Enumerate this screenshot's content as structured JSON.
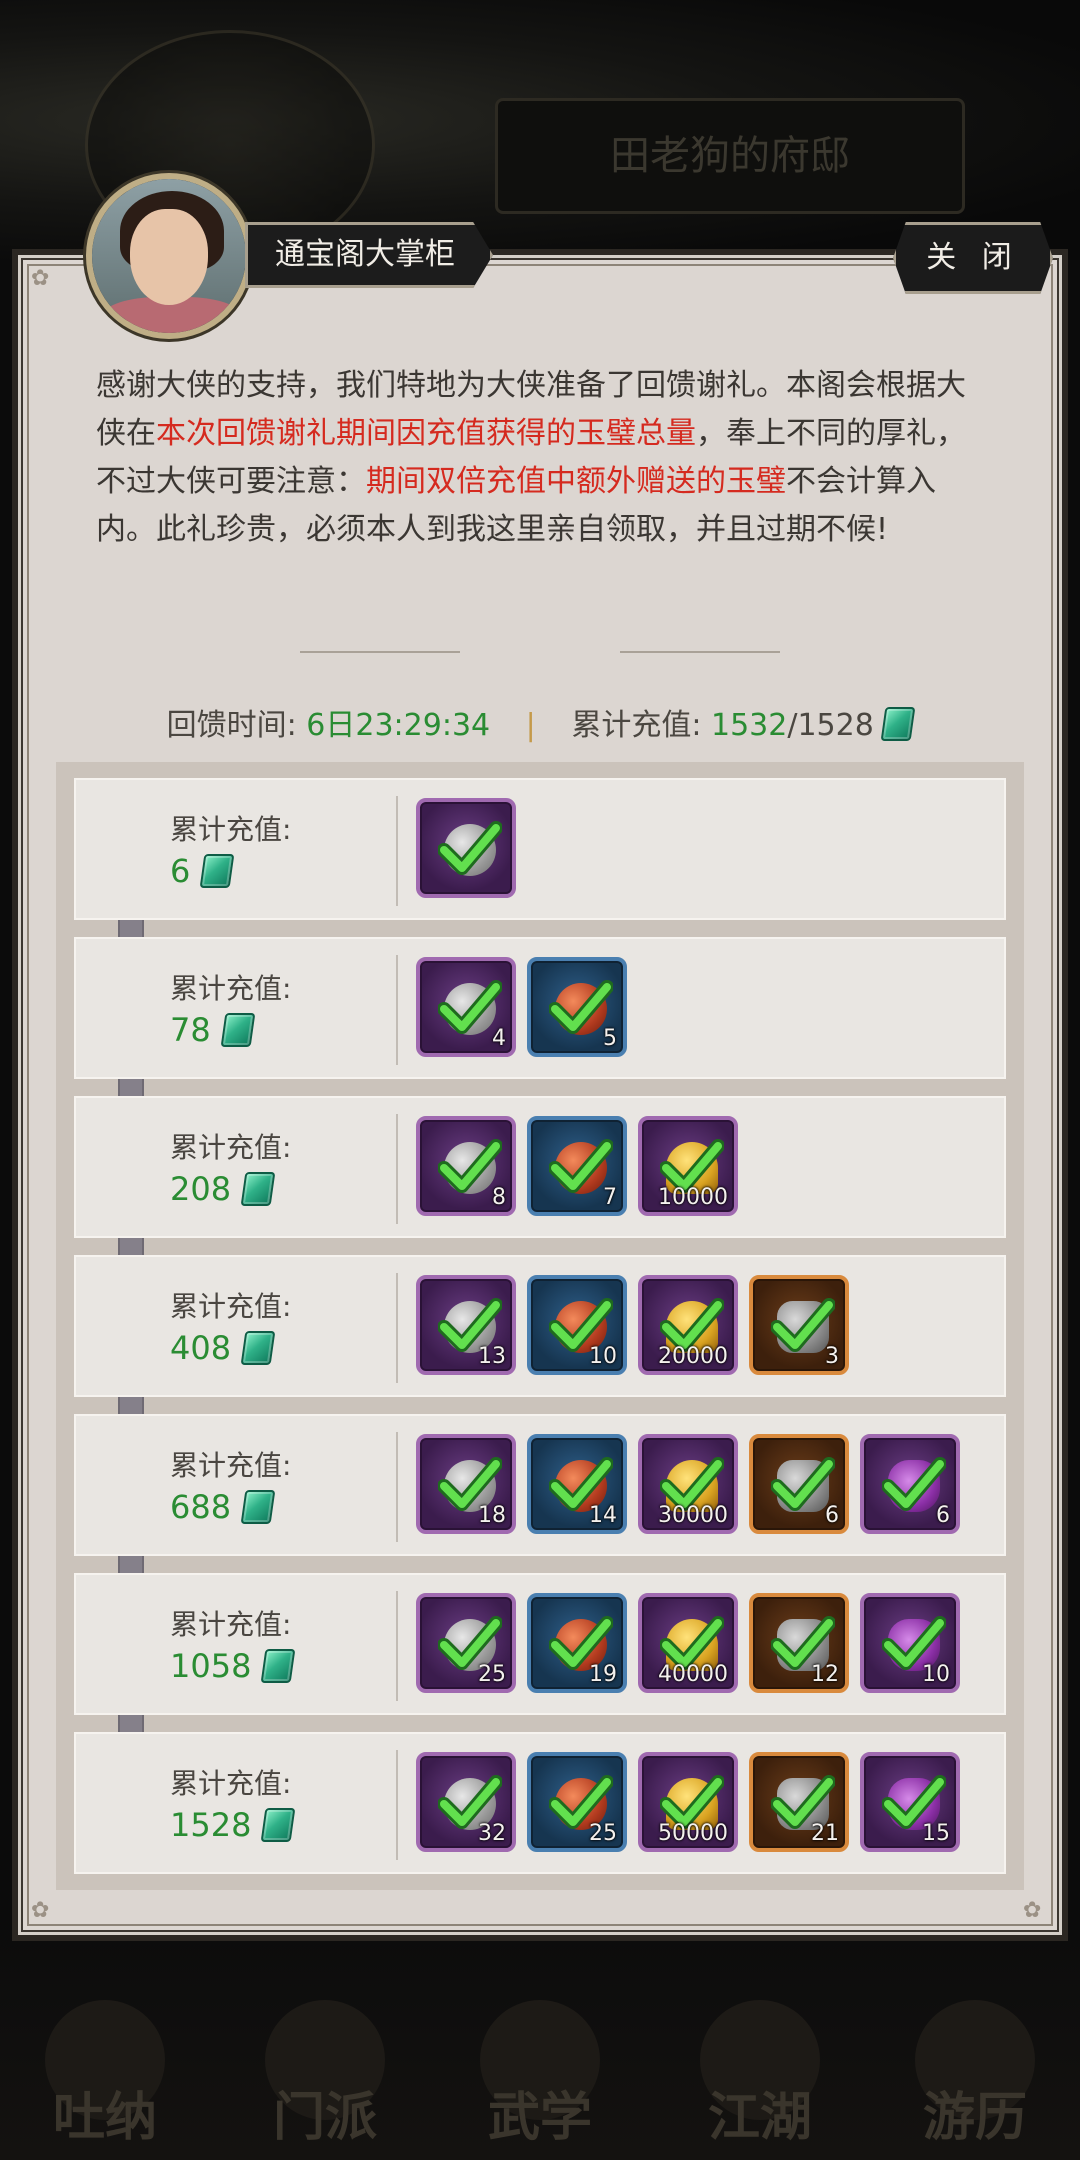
{
  "background": {
    "title": "田老狗的府邸",
    "nav": [
      "吐纳",
      "门派",
      "武学",
      "江湖",
      "游历"
    ]
  },
  "header": {
    "npc_name": "通宝阁大掌柜",
    "close_label": "关 闭"
  },
  "intro": {
    "p1": "感谢大侠的支持，我们特地为大侠准备了回馈谢礼。本阁会根据大侠在",
    "hl1": "本次回馈谢礼期间因充值获得的玉璧总量",
    "p2": "，奉上不同的厚礼，不过大侠可要注意：",
    "hl2": "期间双倍充值中额外赠送的玉璧",
    "p3": "不会计算入内。此礼珍贵，必须本人到我这里亲自领取，并且过期不候!"
  },
  "summary": {
    "time_label": "回馈时间:",
    "time_value": "6日23:29:34",
    "separator": "|",
    "total_label": "累计充值:",
    "total_current": "1532",
    "total_target": "/1528"
  },
  "colors": {
    "highlight_red": "#d52a1f",
    "value_green": "#2a8c33"
  },
  "tiers": [
    {
      "label": "累计充值:",
      "amount": "6",
      "items": [
        {
          "type": "stone",
          "frame": "purple",
          "qty": ""
        }
      ]
    },
    {
      "label": "累计充值:",
      "amount": "78",
      "items": [
        {
          "type": "stone",
          "frame": "purple",
          "qty": "4"
        },
        {
          "type": "pill",
          "frame": "blue",
          "qty": "5"
        }
      ]
    },
    {
      "label": "累计充值:",
      "amount": "208",
      "items": [
        {
          "type": "stone",
          "frame": "purple",
          "qty": "8"
        },
        {
          "type": "pill",
          "frame": "blue",
          "qty": "7"
        },
        {
          "type": "gold",
          "frame": "purple",
          "qty": "10000"
        }
      ]
    },
    {
      "label": "累计充值:",
      "amount": "408",
      "items": [
        {
          "type": "stone",
          "frame": "purple",
          "qty": "13"
        },
        {
          "type": "pill",
          "frame": "blue",
          "qty": "10"
        },
        {
          "type": "gold",
          "frame": "purple",
          "qty": "20000"
        },
        {
          "type": "ore",
          "frame": "orange",
          "qty": "3"
        }
      ]
    },
    {
      "label": "累计充值:",
      "amount": "688",
      "items": [
        {
          "type": "stone",
          "frame": "purple",
          "qty": "18"
        },
        {
          "type": "pill",
          "frame": "blue",
          "qty": "14"
        },
        {
          "type": "gold",
          "frame": "purple",
          "qty": "30000"
        },
        {
          "type": "ore",
          "frame": "orange",
          "qty": "6"
        },
        {
          "type": "bottle",
          "frame": "purple",
          "qty": "6"
        }
      ]
    },
    {
      "label": "累计充值:",
      "amount": "1058",
      "items": [
        {
          "type": "stone",
          "frame": "purple",
          "qty": "25"
        },
        {
          "type": "pill",
          "frame": "blue",
          "qty": "19"
        },
        {
          "type": "gold",
          "frame": "purple",
          "qty": "40000"
        },
        {
          "type": "ore",
          "frame": "orange",
          "qty": "12"
        },
        {
          "type": "bottle",
          "frame": "purple",
          "qty": "10"
        }
      ]
    },
    {
      "label": "累计充值:",
      "amount": "1528",
      "items": [
        {
          "type": "stone",
          "frame": "purple",
          "qty": "32"
        },
        {
          "type": "pill",
          "frame": "blue",
          "qty": "25"
        },
        {
          "type": "gold",
          "frame": "purple",
          "qty": "50000"
        },
        {
          "type": "ore",
          "frame": "orange",
          "qty": "21"
        },
        {
          "type": "bottle",
          "frame": "purple",
          "qty": "15"
        }
      ]
    }
  ]
}
